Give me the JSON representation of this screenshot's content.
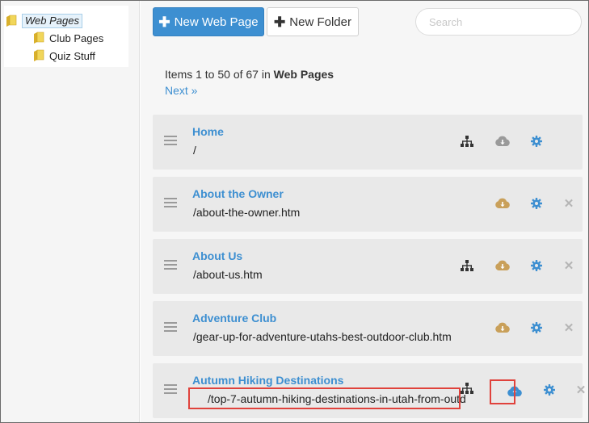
{
  "tree": {
    "root": {
      "label": "Web Pages",
      "icon": "folder-icon"
    },
    "children": [
      {
        "label": "Club Pages",
        "icon": "folder-icon"
      },
      {
        "label": "Quiz Stuff",
        "icon": "folder-icon"
      }
    ]
  },
  "toolbar": {
    "new_page_label": "New Web Page",
    "new_folder_label": "New Folder",
    "search_placeholder": "Search"
  },
  "pager": {
    "prefix": "Items 1 to 50 of 67 in ",
    "folder": "Web Pages",
    "next_label": "Next »"
  },
  "rows": [
    {
      "title": "Home",
      "url": "/",
      "icons": [
        "sitemap-icon",
        "cloud-download-icon",
        "gear-icon"
      ],
      "cloud_color": "#9a9a9a",
      "has_close": false
    },
    {
      "title": "About the Owner",
      "url": "/about-the-owner.htm",
      "icons": [
        "cloud-download-icon",
        "gear-icon",
        "close-icon"
      ],
      "cloud_color": "#c9a05a",
      "has_close": true
    },
    {
      "title": "About Us",
      "url": "/about-us.htm",
      "icons": [
        "sitemap-icon",
        "cloud-download-icon",
        "gear-icon",
        "close-icon"
      ],
      "cloud_color": "#c9a05a",
      "has_close": true
    },
    {
      "title": "Adventure Club",
      "url": "/gear-up-for-adventure-utahs-best-outdoor-club.htm",
      "icons": [
        "cloud-download-icon",
        "gear-icon",
        "close-icon"
      ],
      "cloud_color": "#c9a05a",
      "has_close": true
    },
    {
      "title": "Autumn Hiking Destinations",
      "url": "/top-7-autumn-hiking-destinations-in-utah-from-outd",
      "icons": [
        "sitemap-icon",
        "cloud-upload-icon",
        "gear-icon",
        "close-icon"
      ],
      "cloud_color": "#3d8fd1",
      "has_close": true
    }
  ],
  "close_glyph": "✕",
  "colors": {
    "accent": "#3d8fd1",
    "highlight": "#e0423c",
    "folder": "#e8c53a"
  }
}
